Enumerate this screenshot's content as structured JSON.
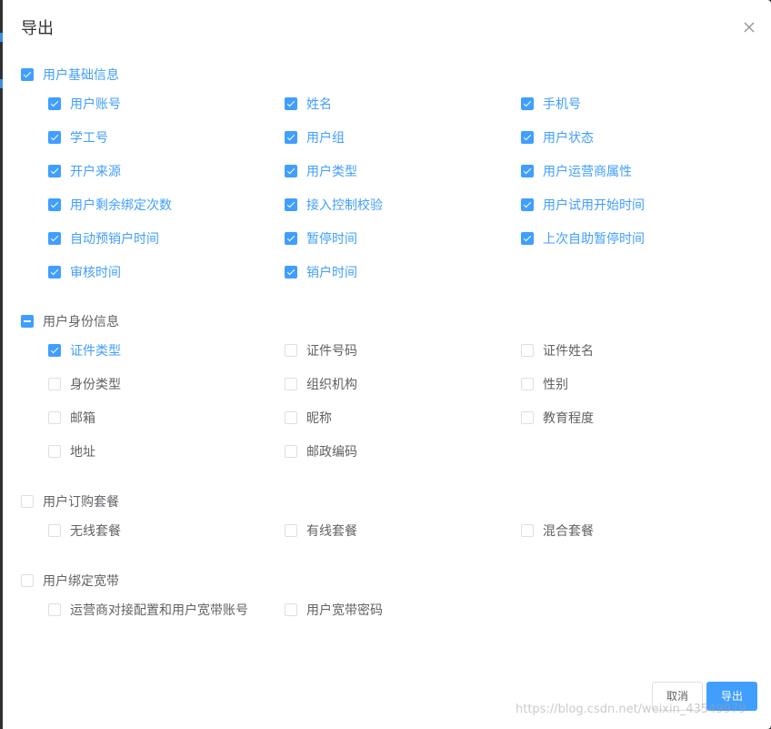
{
  "dialog": {
    "title": "导出",
    "cancel_label": "取消",
    "export_label": "导出"
  },
  "groups": [
    {
      "label": "用户基础信息",
      "state": "checked",
      "items": [
        {
          "label": "用户账号",
          "checked": true
        },
        {
          "label": "姓名",
          "checked": true
        },
        {
          "label": "手机号",
          "checked": true
        },
        {
          "label": "学工号",
          "checked": true
        },
        {
          "label": "用户组",
          "checked": true
        },
        {
          "label": "用户状态",
          "checked": true
        },
        {
          "label": "开户来源",
          "checked": true
        },
        {
          "label": "用户类型",
          "checked": true
        },
        {
          "label": "用户运营商属性",
          "checked": true
        },
        {
          "label": "用户剩余绑定次数",
          "checked": true
        },
        {
          "label": "接入控制校验",
          "checked": true
        },
        {
          "label": "用户试用开始时间",
          "checked": true
        },
        {
          "label": "自动预销户时间",
          "checked": true
        },
        {
          "label": "暂停时间",
          "checked": true
        },
        {
          "label": "上次自助暂停时间",
          "checked": true
        },
        {
          "label": "审核时间",
          "checked": true
        },
        {
          "label": "销户时间",
          "checked": true
        }
      ]
    },
    {
      "label": "用户身份信息",
      "state": "indeterminate",
      "items": [
        {
          "label": "证件类型",
          "checked": true
        },
        {
          "label": "证件号码",
          "checked": false
        },
        {
          "label": "证件姓名",
          "checked": false
        },
        {
          "label": "身份类型",
          "checked": false
        },
        {
          "label": "组织机构",
          "checked": false
        },
        {
          "label": "性别",
          "checked": false
        },
        {
          "label": "邮箱",
          "checked": false
        },
        {
          "label": "昵称",
          "checked": false
        },
        {
          "label": "教育程度",
          "checked": false
        },
        {
          "label": "地址",
          "checked": false
        },
        {
          "label": "邮政编码",
          "checked": false
        }
      ]
    },
    {
      "label": "用户订购套餐",
      "state": "unchecked",
      "items": [
        {
          "label": "无线套餐",
          "checked": false
        },
        {
          "label": "有线套餐",
          "checked": false
        },
        {
          "label": "混合套餐",
          "checked": false
        }
      ]
    },
    {
      "label": "用户绑定宽带",
      "state": "unchecked",
      "items": [
        {
          "label": "运营商对接配置和用户宽带账号",
          "checked": false
        },
        {
          "label": "用户宽带密码",
          "checked": false
        }
      ]
    }
  ],
  "watermark": "https://blog.csdn.net/weixin_43549979",
  "colors": {
    "primary": "#409eff",
    "border": "#dcdfe6",
    "text": "#606266",
    "title": "#303133"
  }
}
